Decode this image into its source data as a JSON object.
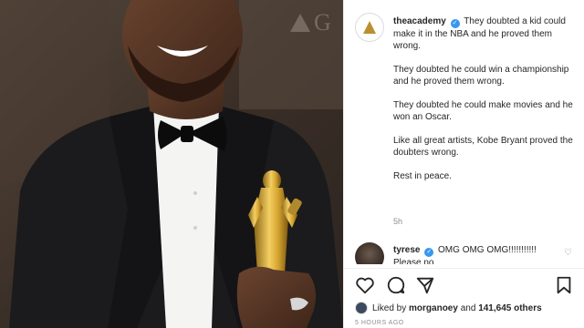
{
  "post": {
    "background_watermark": "G",
    "account": "theacademy",
    "caption_lines": [
      "They doubted a kid could make it in the NBA and he proved them wrong.",
      "They doubted he could win a championship and he proved them wrong.",
      "They doubted he could make movies and he won an Oscar.",
      "Like all great artists, Kobe Bryant proved the doubters wrong.",
      "Rest in peace."
    ],
    "time_ago": "5h"
  },
  "comment": {
    "user": "tyrese",
    "text": "OMG OMG OMG!!!!!!!!!!! Please no"
  },
  "likes": {
    "prefix": "Liked by",
    "user": "morganoey",
    "and": "and",
    "count": "141,645 others"
  },
  "posted": "5 HOURS AGO",
  "icons": {
    "like": "heart-icon",
    "comment": "comment-bubble-icon",
    "share": "paper-plane-icon",
    "save": "bookmark-icon",
    "verified": "verified-badge-icon"
  },
  "colors": {
    "verified_blue": "#3897f0",
    "academy_gold": "#b8912f",
    "muted": "#8e8e8e"
  }
}
